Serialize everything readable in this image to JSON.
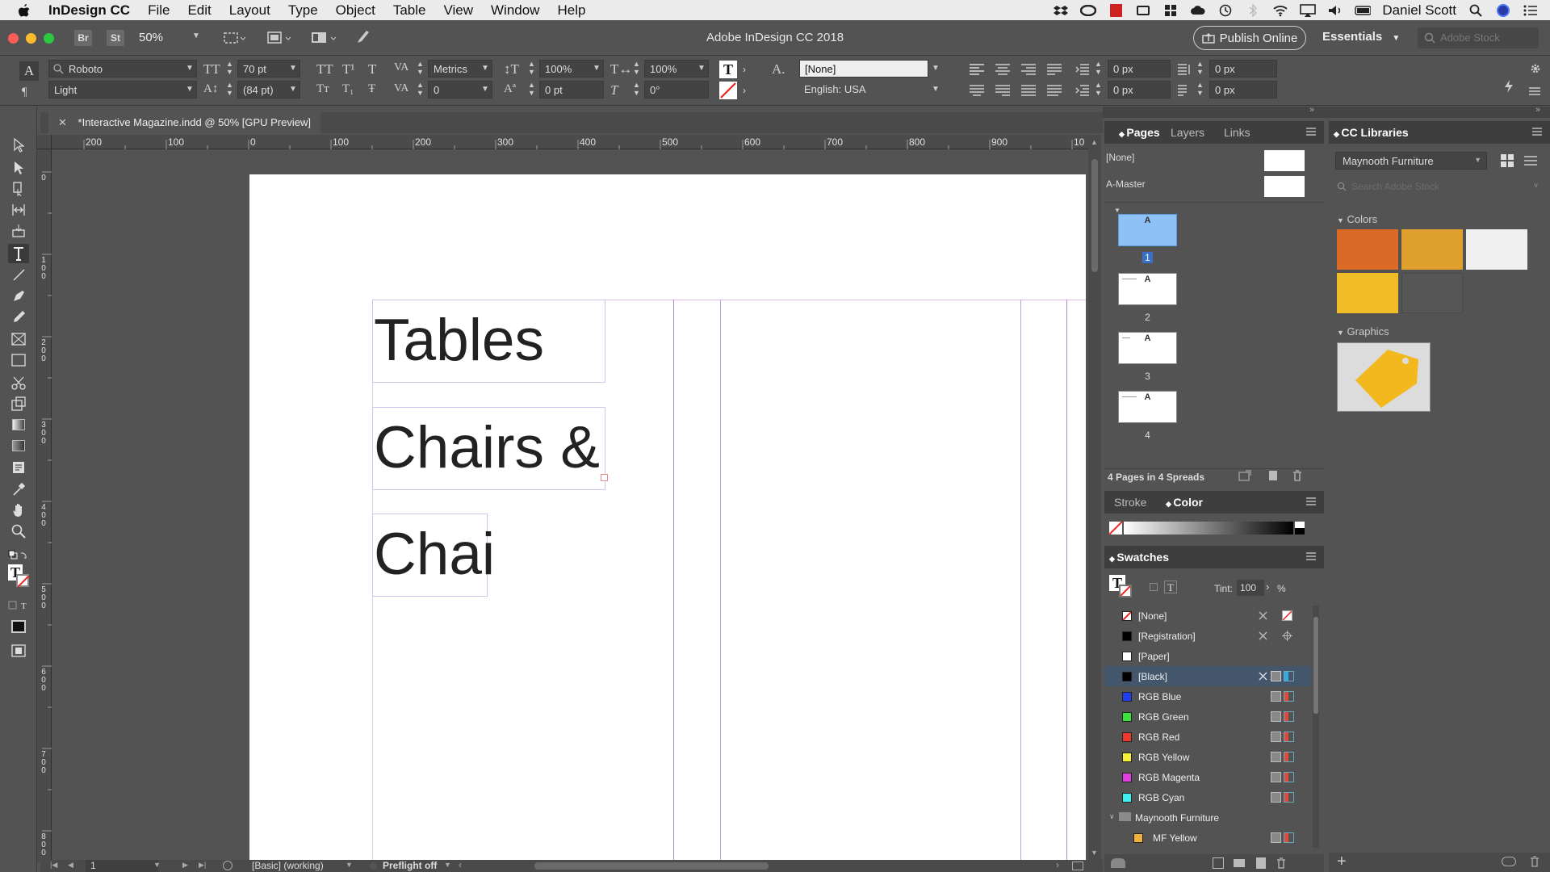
{
  "menubar": {
    "apple": "",
    "app_name": "InDesign CC",
    "items": [
      "File",
      "Edit",
      "Layout",
      "Type",
      "Object",
      "Table",
      "View",
      "Window",
      "Help"
    ],
    "user": "Daniel Scott"
  },
  "appbar": {
    "br_label": "Br",
    "st_label": "St",
    "zoom": "50%",
    "title": "Adobe InDesign CC 2018",
    "publish": "Publish Online",
    "workspace": "Essentials",
    "stock_placeholder": "Adobe Stock"
  },
  "control": {
    "font_family": "Roboto",
    "font_style": "Light",
    "font_size": "70 pt",
    "leading": "(84 pt)",
    "kerning": "Metrics",
    "tracking": "0",
    "vscale": "100%",
    "hscale": "100%",
    "baseline": "0 pt",
    "skew": "0°",
    "char_style": "[None]",
    "language": "English: USA",
    "indent_left": "0 px",
    "indent_first": "0 px",
    "space_before": "0 px",
    "space_after": "0 px"
  },
  "doc_tab": "*Interactive Magazine.indd @ 50% [GPU Preview]",
  "ruler_h": [
    "200",
    "100",
    "0",
    "100",
    "200",
    "300",
    "400",
    "500",
    "600",
    "700",
    "800",
    "900",
    "10"
  ],
  "ruler_v": [
    "0",
    "100",
    "200",
    "300",
    "400",
    "500",
    "600",
    "700",
    "800"
  ],
  "frames": {
    "t1": "Tables",
    "t2": "Chairs &",
    "t3": "Chai"
  },
  "status": {
    "page": "1",
    "style": "[Basic] (working)",
    "preflight": "Preflight off"
  },
  "pages_panel": {
    "tabs": [
      "Pages",
      "Layers",
      "Links"
    ],
    "none": "[None]",
    "master": "A-Master",
    "page_numbers": [
      "1",
      "2",
      "3",
      "4"
    ],
    "master_letter": "A",
    "footer": "4 Pages in 4 Spreads"
  },
  "color_panel": {
    "tabs": [
      "Stroke",
      "Color"
    ]
  },
  "swatches": {
    "title": "Swatches",
    "tint_label": "Tint:",
    "tint": "100",
    "percent": "%",
    "rows": [
      {
        "name": "[None]",
        "color": "#ffffff"
      },
      {
        "name": "[Registration]",
        "color": "#000000"
      },
      {
        "name": "[Paper]",
        "color": "#ffffff"
      },
      {
        "name": "[Black]",
        "color": "#000000"
      },
      {
        "name": "RGB Blue",
        "color": "#1f3ff0"
      },
      {
        "name": "RGB Green",
        "color": "#3ee03e"
      },
      {
        "name": "RGB Red",
        "color": "#ee3a2c"
      },
      {
        "name": "RGB Yellow",
        "color": "#f6f03a"
      },
      {
        "name": "RGB Magenta",
        "color": "#e040e0"
      },
      {
        "name": "RGB Cyan",
        "color": "#3ef0f0"
      },
      {
        "name": "Maynooth Furniture",
        "color": ""
      },
      {
        "name": "MF Yellow",
        "color": "#f0b23a"
      }
    ]
  },
  "libraries": {
    "title": "CC Libraries",
    "library": "Maynooth Furniture",
    "search_placeholder": "Search Adobe Stock",
    "colors_heading": "Colors",
    "graphics_heading": "Graphics",
    "colors": [
      "#dc6a27",
      "#dfa02d",
      "#f0f0f0",
      "#f1bd27",
      "#565656"
    ]
  }
}
